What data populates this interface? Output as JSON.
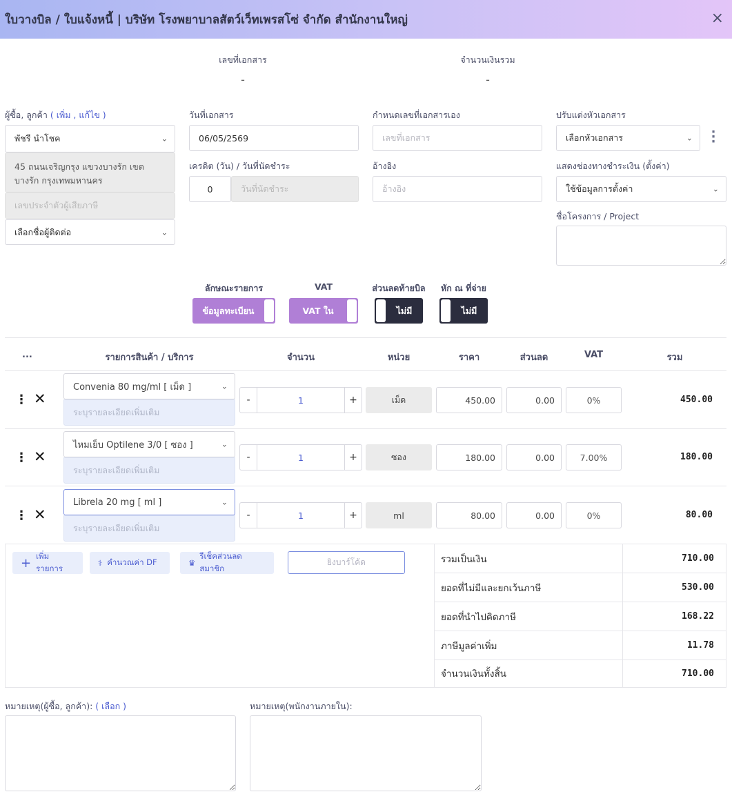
{
  "header": {
    "title": "ใบวางบิล / ใบแจ้งหนี้ | บริษัท โรงพยาบาลสัตว์เว็ทเพรสโซ่ จำกัด สำนักงานใหญ่",
    "close": "×"
  },
  "summary_top": {
    "doc_no_label": "เลขที่เอกสาร",
    "doc_no_value": "-",
    "amount_label": "จำนวนเงินรวม",
    "amount_value": "-"
  },
  "buyer": {
    "label": "ผู้ซื้อ, ลูกค้า",
    "label_links": "( เพิ่ม , แก้ไข )",
    "name": "พัชรี นำโชค",
    "address": "45 ถนนเจริญกรุง แขวงบางรัก เขตบางรัก กรุงเทพมหานคร",
    "tax_id_placeholder": "เลขประจำตัวผู้เสียภาษี",
    "contact_select": "เลือกชื่อผู้ติดต่อ"
  },
  "doc_date": {
    "label": "วันที่เอกสาร",
    "value": "06/05/2569"
  },
  "credit": {
    "label": "เครดิต (วัน) / วันที่นัดชำระ",
    "days": "0",
    "due_placeholder": "วันที่นัดชำระ"
  },
  "custom_no": {
    "label": "กำหนดเลขที่เอกสารเอง",
    "placeholder": "เลขที่เอกสาร"
  },
  "reference": {
    "label": "อ้างอิง",
    "placeholder": "อ้างอิง"
  },
  "header_custom": {
    "label": "ปรับแต่งหัวเอกสาร",
    "select": "เลือกหัวเอกสาร"
  },
  "payment_channel": {
    "label": "แสดงช่องทางชำระเงิน (ตั้งค่า)",
    "select": "ใช้ข้อมูลการตั้งค่า"
  },
  "project": {
    "label": "ชื่อโครงการ / Project"
  },
  "toggles": [
    {
      "label": "ลักษณะรายการ",
      "value": "ข้อมูลทะเบียน",
      "on": true
    },
    {
      "label": "VAT",
      "value": "VAT ใน",
      "on": true
    },
    {
      "label": "ส่วนลดท้ายบิล",
      "value": "ไม่มี",
      "on": false
    },
    {
      "label": "หัก ณ ที่จ่าย",
      "value": "ไม่มี",
      "on": false
    }
  ],
  "table": {
    "headers": {
      "menu": "...",
      "item": "รายการสินค้า / บริการ",
      "qty": "จำนวน",
      "unit": "หน่วย",
      "price": "ราคา",
      "discount": "ส่วนลด",
      "vat": "VAT",
      "total": "รวม"
    },
    "desc_placeholder": "ระบุรายละเอียดเพิ่มเติม",
    "rows": [
      {
        "item": "Convenia 80 mg/ml [ เม็ด ]",
        "qty": "1",
        "unit": "เม็ด",
        "price": "450.00",
        "discount": "0.00",
        "vat": "0%",
        "total": "450.00"
      },
      {
        "item": "ไหมเย็บ Optilene 3/0 [ ซอง ]",
        "qty": "1",
        "unit": "ซอง",
        "price": "180.00",
        "discount": "0.00",
        "vat": "7.00%",
        "total": "180.00"
      },
      {
        "item": "Librela 20 mg [ ml ]",
        "qty": "1",
        "unit": "ml",
        "price": "80.00",
        "discount": "0.00",
        "vat": "0%",
        "total": "80.00"
      }
    ]
  },
  "actions": {
    "add_item": "เพิ่มรายการ",
    "calc_df": "คำนวณค่า DF",
    "member_discount": "รีเช็คส่วนลดสมาชิก",
    "barcode": "ยิงบาร์โค้ด"
  },
  "totals": [
    {
      "label": "รวมเป็นเงิน",
      "value": "710.00"
    },
    {
      "label": "ยอดที่ไม่มีและยกเว้นภาษี",
      "value": "530.00"
    },
    {
      "label": "ยอดที่นำไปคิดภาษี",
      "value": "168.22"
    },
    {
      "label": "ภาษีมูลค่าเพิ่ม",
      "value": "11.78"
    },
    {
      "label": "จำนวนเงินทั้งสิ้น",
      "value": "710.00"
    }
  ],
  "notes": {
    "customer_label": "หมายเหตุ(ผู้ซื้อ, ลูกค้า):",
    "customer_link": "( เลือก )",
    "internal_label": "หมายเหตุ(พนักงานภายใน):"
  },
  "colors": {
    "accent": "#b07fd6",
    "dark_toggle": "#2b2d3e",
    "link": "#4a5bd0"
  }
}
